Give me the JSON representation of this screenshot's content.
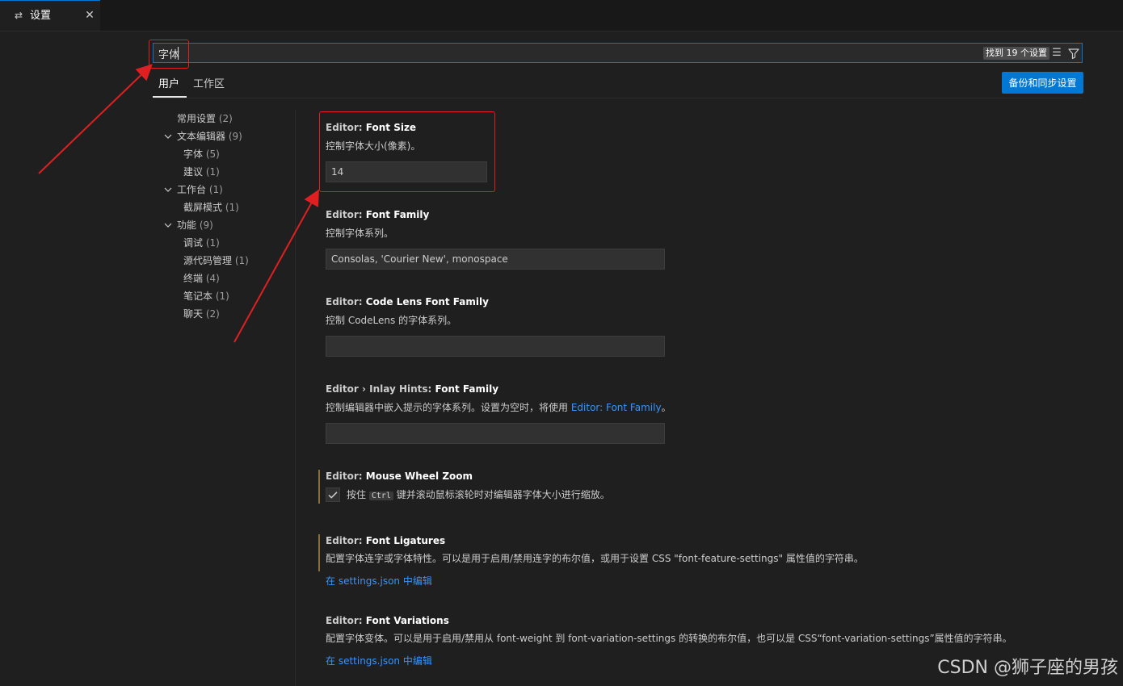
{
  "tab": {
    "title": "设置",
    "icon": "settings-sliders-icon",
    "close_icon": "close-icon"
  },
  "search": {
    "value": "字体",
    "result_count": "找到 19 个设置",
    "clear_icon": "clear-filter-icon",
    "filter_icon": "filter-icon"
  },
  "scopes": {
    "user": "用户",
    "workspace": "工作区"
  },
  "sync_button": "备份和同步设置",
  "toc": [
    {
      "label": "常用设置",
      "count": "(2)"
    },
    {
      "label": "文本编辑器",
      "count": "(9)"
    },
    {
      "label": "字体",
      "count": "(5)"
    },
    {
      "label": "建议",
      "count": "(1)"
    },
    {
      "label": "工作台",
      "count": "(1)"
    },
    {
      "label": "截屏模式",
      "count": "(1)"
    },
    {
      "label": "功能",
      "count": "(9)"
    },
    {
      "label": "调试",
      "count": "(1)"
    },
    {
      "label": "源代码管理",
      "count": "(1)"
    },
    {
      "label": "终端",
      "count": "(4)"
    },
    {
      "label": "笔记本",
      "count": "(1)"
    },
    {
      "label": "聊天",
      "count": "(2)"
    }
  ],
  "settings": {
    "font_size": {
      "category": "Editor: ",
      "name": "Font Size",
      "desc": "控制字体大小(像素)。",
      "value": "14"
    },
    "font_family": {
      "category": "Editor: ",
      "name": "Font Family",
      "desc": "控制字体系列。",
      "value": "Consolas, 'Courier New', monospace"
    },
    "codelens_font_family": {
      "category": "Editor: ",
      "name": "Code Lens Font Family",
      "desc": "控制 CodeLens 的字体系列。",
      "value": ""
    },
    "inlay_hints_font_family": {
      "category": "Editor › Inlay Hints: ",
      "name": "Font Family",
      "desc": "控制编辑器中嵌入提示的字体系列。设置为空时，将使用 ",
      "desc_link": "Editor: Font Family",
      "desc_end": "。",
      "value": ""
    },
    "mouse_wheel_zoom": {
      "category": "Editor: ",
      "name": "Mouse Wheel Zoom",
      "checked": true,
      "desc_before": "按住 ",
      "key": "Ctrl",
      "desc_after": " 键并滚动鼠标滚轮时对编辑器字体大小进行缩放。"
    },
    "font_ligatures": {
      "category": "Editor: ",
      "name": "Font Ligatures",
      "desc": "配置字体连字或字体特性。可以是用于启用/禁用连字的布尔值，或用于设置 CSS \"font-feature-settings\" 属性值的字符串。",
      "link": "在 settings.json 中编辑"
    },
    "font_variations": {
      "category": "Editor: ",
      "name": "Font Variations",
      "desc": "配置字体变体。可以是用于启用/禁用从 font-weight 到 font-variation-settings 的转换的布尔值，也可以是 CSS“font-variation-settings”属性值的字符串。",
      "link": "在 settings.json 中编辑"
    }
  },
  "watermark": "CSDN @狮子座的男孩",
  "annotation_color": "#e02020"
}
